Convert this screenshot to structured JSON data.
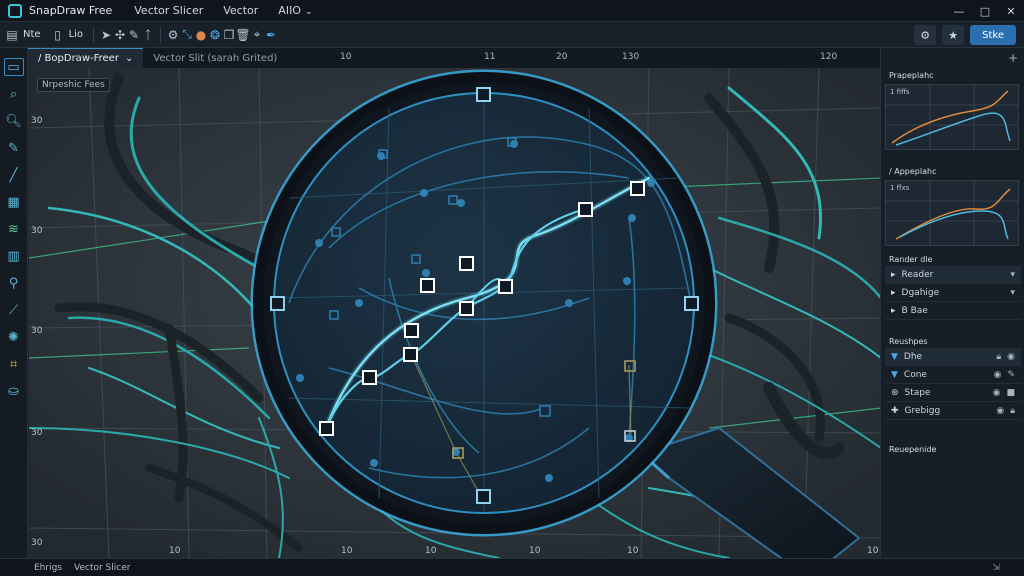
{
  "titlebar": {
    "app_title": "SnapDraw Free",
    "menu": [
      "Vector Slicer",
      "Vector",
      "AIIO"
    ],
    "controls": [
      "—",
      "□",
      "✕"
    ]
  },
  "toolbar": {
    "file_label": "Nte",
    "edit_label": "Lio",
    "share_label": "Stke"
  },
  "tabs": [
    {
      "label": "/ BopDraw-Freer",
      "active": true
    },
    {
      "label": "Vector Slit (sarah Grited)",
      "active": false
    }
  ],
  "ruler": {
    "top": [
      "10",
      "11",
      "20",
      "130",
      "120"
    ],
    "left": [
      "30",
      "30",
      "30",
      "30",
      "30"
    ],
    "bottom": [
      "10",
      "10",
      "10",
      "10",
      "10",
      "10"
    ]
  },
  "canvas": {
    "label": "Nrpeshic Fees"
  },
  "right_panel": {
    "preview1_title": "Prapeplahc",
    "preview1_inner": "1 fiffs",
    "preview2_title": "/ Appeplahc",
    "preview2_inner": "1 ffxs",
    "layers_title": "Rander dle",
    "layers": [
      {
        "name": "Reader",
        "sel": true
      },
      {
        "name": "Dgahige",
        "sel": false
      },
      {
        "name": "B Bae",
        "sel": false
      }
    ],
    "objects_title": "Reushpes",
    "objects": [
      {
        "name": "Dhe",
        "sel": true
      },
      {
        "name": "Cone",
        "sel": false
      },
      {
        "name": "Stape",
        "sel": false
      },
      {
        "name": "Grebigg",
        "sel": false
      }
    ],
    "props_title": "Reuepenide"
  },
  "statusbar": {
    "items": [
      "Ehrigs",
      "Vector Slicer"
    ]
  },
  "colors": {
    "accent": "#3ec6d8",
    "path": "#5fd0e8",
    "handle": "#ffffff",
    "share": "#2a6fb0"
  }
}
